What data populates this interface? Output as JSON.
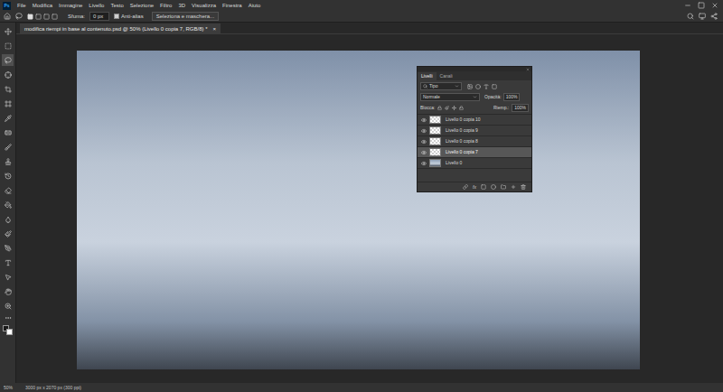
{
  "app": {
    "logo": "Ps"
  },
  "menu": [
    "File",
    "Modifica",
    "Immagine",
    "Livello",
    "Testo",
    "Selezione",
    "Filtro",
    "3D",
    "Visualizza",
    "Finestra",
    "Aiuto"
  ],
  "options_bar": {
    "feather_label": "Sfuma:",
    "feather_value": "0 px",
    "antialias": {
      "label": "Anti-alias",
      "checked": true
    },
    "mask_button": "Seleziona e maschera..."
  },
  "document_tab": {
    "title": "modifica riempi in base al contenuto.psd @ 50% (Livello 0 copia 7, RGB/8) *",
    "close": "×",
    "selected": true
  },
  "tools": [
    {
      "selected": false
    },
    {
      "selected": false
    },
    {
      "selected": true
    },
    {
      "selected": false
    },
    {
      "selected": false
    },
    {
      "selected": false
    },
    {
      "selected": false
    },
    {
      "selected": false
    },
    {
      "selected": false
    },
    {
      "selected": false
    },
    {
      "selected": false
    },
    {
      "selected": false
    },
    {
      "selected": false
    },
    {
      "selected": false
    },
    {
      "selected": false
    },
    {
      "selected": false
    },
    {
      "selected": false
    },
    {
      "selected": false
    },
    {
      "selected": false
    },
    {
      "selected": false
    }
  ],
  "layers_panel": {
    "tabs": [
      {
        "label": "Livelli",
        "selected": true
      },
      {
        "label": "Canali",
        "selected": false
      }
    ],
    "filter": "Tipo",
    "blend_mode": "Normale",
    "opacity_label": "Opacità:",
    "opacity": "100%",
    "lock_label": "Blocca:",
    "fill_label": "Riemp.:",
    "fill": "100%",
    "fx": "fx",
    "layers": [
      {
        "name": "Livello 0 copia 10",
        "visible": true,
        "selected": false,
        "kind": "transparent"
      },
      {
        "name": "Livello 0 copia 9",
        "visible": true,
        "selected": false,
        "kind": "transparent"
      },
      {
        "name": "Livello 0 copia 8",
        "visible": true,
        "selected": false,
        "kind": "transparent"
      },
      {
        "name": "Livello 0 copia 7",
        "visible": true,
        "selected": true,
        "kind": "transparent"
      },
      {
        "name": "Livello 0",
        "visible": true,
        "selected": false,
        "kind": "photo"
      }
    ]
  },
  "status_bar": {
    "zoom": "50%",
    "info": "3000 px x 2070 px (300 ppi)"
  }
}
